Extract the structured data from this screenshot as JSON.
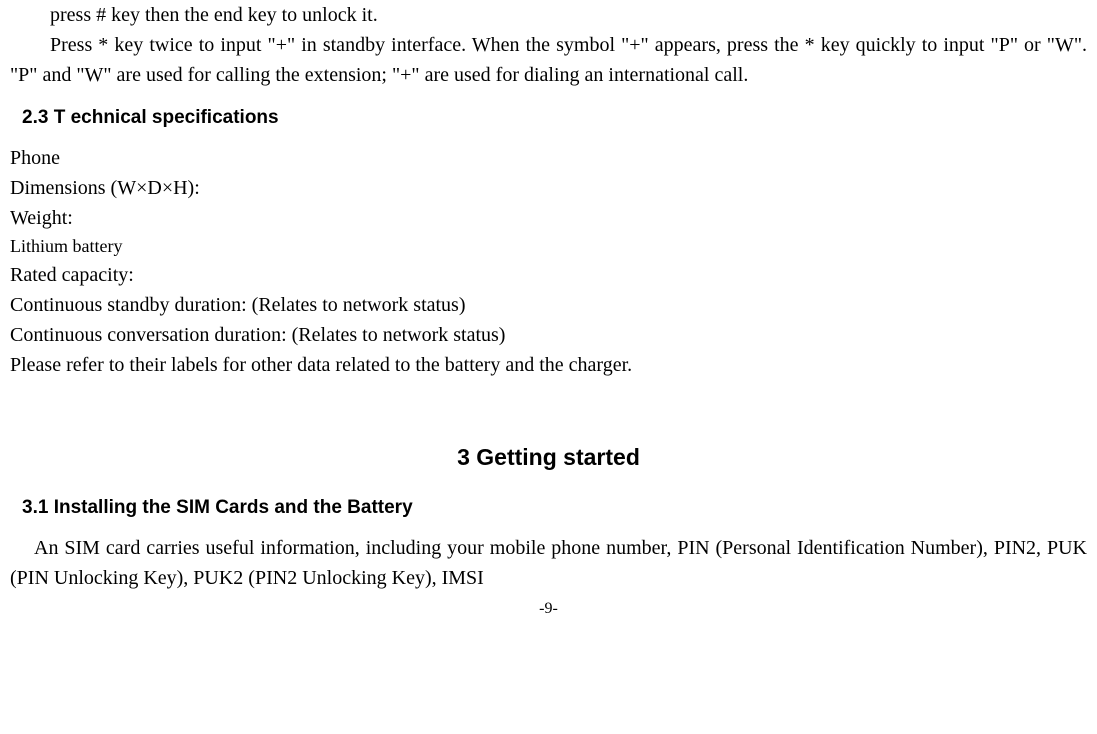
{
  "top_para_line1": "press # key then the end key to unlock it.",
  "top_para_full": "Press * key twice to input \"+\" in standby interface. When the symbol \"+\" appears, press the * key quickly to input \"P\" or \"W\". \"P\" and \"W\" are used for calling the extension; \"+\" are used for dialing an international call.",
  "section23_heading": "2.3 T    echnical specifications",
  "section23": {
    "phone_label": "Phone",
    "dimensions": "Dimensions (W×D×H):",
    "weight": "Weight:",
    "battery_label": "Lithium battery",
    "rated_capacity": "Rated capacity:",
    "standby": "Continuous standby duration: (Relates to network status)",
    "conversation": "Continuous conversation duration: (Relates to network status)",
    "refer": "Please refer to their labels for other data related to the battery and the charger."
  },
  "chapter3_heading": "3  Getting started",
  "section31_heading": "3.1    Installing the SIM Cards and the Battery",
  "section31_para": "An SIM card carries useful information, including your mobile phone number, PIN (Personal Identification Number), PIN2, PUK (PIN Unlocking Key), PUK2 (PIN2 Unlocking Key), IMSI",
  "page_number": "-9-"
}
